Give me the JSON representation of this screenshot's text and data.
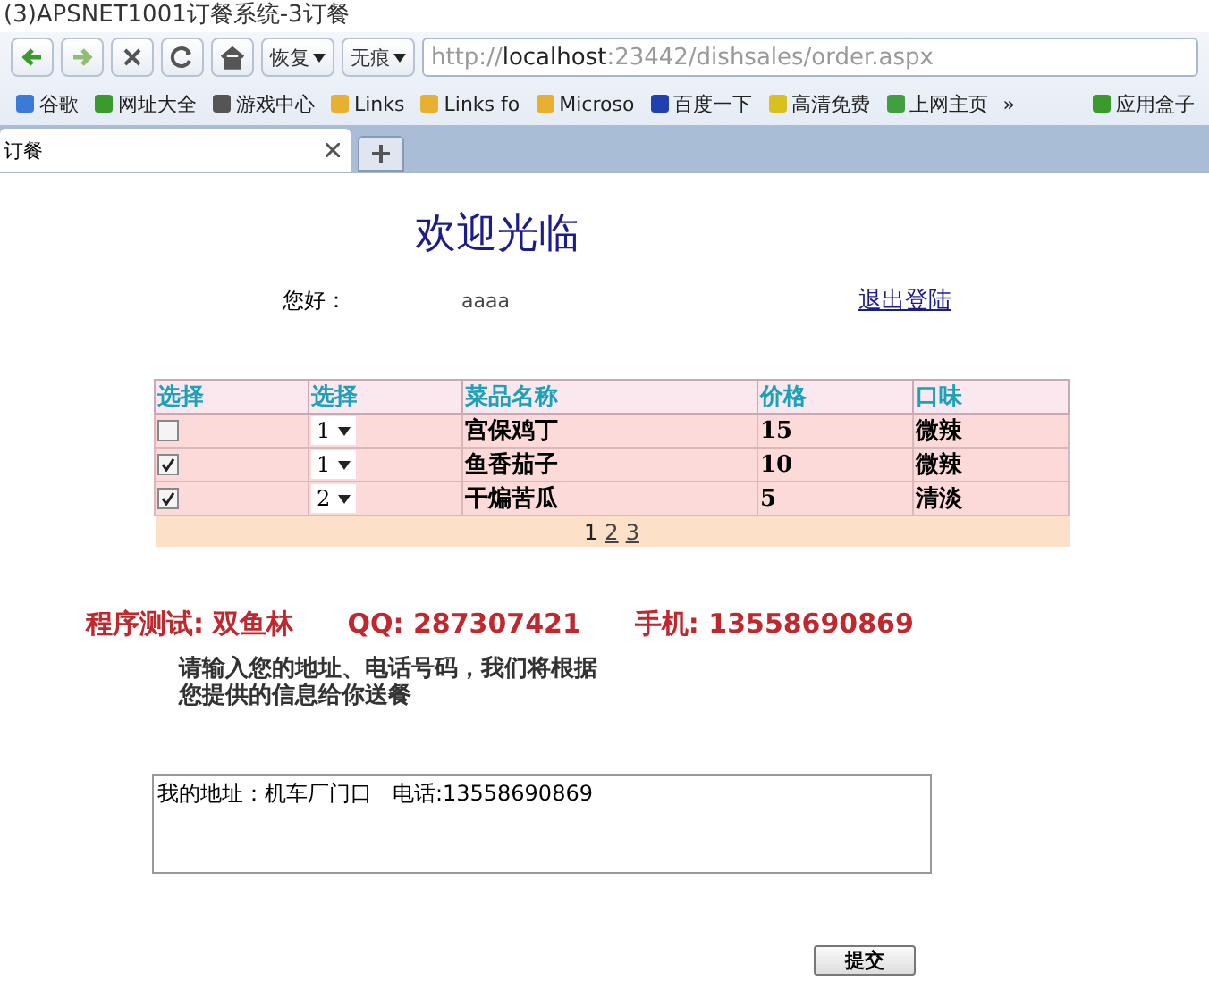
{
  "window": {
    "title": "(3)APSNET1001订餐系统-3订餐"
  },
  "toolbar": {
    "buttons": [
      {
        "kind": "back"
      },
      {
        "kind": "forward"
      },
      {
        "kind": "stop"
      },
      {
        "kind": "refresh"
      },
      {
        "kind": "home"
      }
    ],
    "restore": "恢复",
    "incognito": "无痕",
    "address": {
      "prefix": "http://",
      "host": "localhost",
      "rest": ":23442/dishsales/order.aspx"
    }
  },
  "bookmarks": {
    "items": [
      {
        "label": "谷歌",
        "color": "#3b7bd8"
      },
      {
        "label": "网址大全",
        "color": "#3a9a2c"
      },
      {
        "label": "游戏中心",
        "color": "#555555"
      },
      {
        "label": "Links",
        "color": "#e8b030"
      },
      {
        "label": "Links fo",
        "color": "#e8b030"
      },
      {
        "label": "Microso",
        "color": "#e8b030"
      },
      {
        "label": "百度一下",
        "color": "#2040b0"
      },
      {
        "label": "高清免费",
        "color": "#d8c020"
      },
      {
        "label": "上网主页",
        "color": "#40a040"
      }
    ],
    "more": "»",
    "app_box": "应用盒子"
  },
  "tabs": [
    {
      "label": "订餐",
      "selected": true
    }
  ],
  "page": {
    "heading": "欢迎光临",
    "greeting_label": "您好：",
    "username": "aaaa",
    "logout": "退出登陆",
    "table": {
      "columns": [
        "选择",
        "选择",
        "菜品名称",
        "价格",
        "口味"
      ],
      "rows": [
        {
          "checked": false,
          "quantity": "1",
          "name": "宫保鸡丁",
          "price": "15",
          "taste": "微辣"
        },
        {
          "checked": true,
          "quantity": "1",
          "name": "鱼香茄子",
          "price": "10",
          "taste": "微辣"
        },
        {
          "checked": true,
          "quantity": "2",
          "name": "干煸苦瓜",
          "price": "5",
          "taste": "清淡"
        }
      ],
      "pages": [
        {
          "label": "1",
          "selected": true
        },
        {
          "label": "2",
          "selected": false
        },
        {
          "label": "3",
          "selected": false
        }
      ]
    },
    "promo": [
      "程序测试: 双鱼林",
      "QQ: 287307421",
      "手机: 13558690869"
    ],
    "instruction": [
      "请输入您的地址、电话号码，我们将根据",
      "您提供的信息给你送餐"
    ],
    "address_value": "我的地址：机车厂门口   电话:13558690869",
    "submit": "提交"
  }
}
